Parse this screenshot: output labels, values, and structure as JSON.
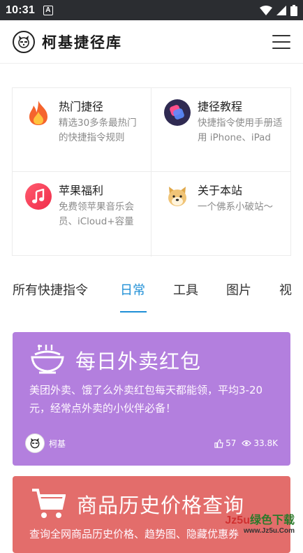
{
  "status_bar": {
    "time": "10:31",
    "notif_letter": "A"
  },
  "header": {
    "title": "柯基捷径库"
  },
  "features": [
    {
      "title": "热门捷径",
      "desc": "精选30多条最热门的快捷指令规则",
      "icon": "fire-icon"
    },
    {
      "title": "捷径教程",
      "desc": "快捷指令使用手册适用 iPhone、iPad",
      "icon": "shortcuts-icon"
    },
    {
      "title": "苹果福利",
      "desc": "免费领苹果音乐会员、iCloud+容量",
      "icon": "music-icon"
    },
    {
      "title": "关于本站",
      "desc": "一个佛系小破站～",
      "icon": "doge-icon"
    }
  ],
  "tabs": [
    {
      "label": "所有快捷指令"
    },
    {
      "label": "日常",
      "active": true
    },
    {
      "label": "工具"
    },
    {
      "label": "图片"
    },
    {
      "label": "视"
    }
  ],
  "cards": [
    {
      "title": "每日外卖红包",
      "desc": "美团外卖、饿了么外卖红包每天都能领，平均3-20元，经常点外卖的小伙伴必备！",
      "author": "柯基",
      "likes": "57",
      "views": "33.8K",
      "color": "#b37fde",
      "icon": "food-bowl-icon"
    },
    {
      "title": "商品历史价格查询",
      "desc": "查询全网商品历史价格、趋势图、隐藏优惠券",
      "color": "#e36d6b",
      "icon": "shopping-cart-icon"
    }
  ],
  "watermark": {
    "line1a": "Jz5u",
    "line1b": "绿色下载",
    "line2": "www.Jz5u.Com"
  },
  "colors": {
    "accent": "#1f8fd6",
    "status_bar": "#2b2d31"
  }
}
